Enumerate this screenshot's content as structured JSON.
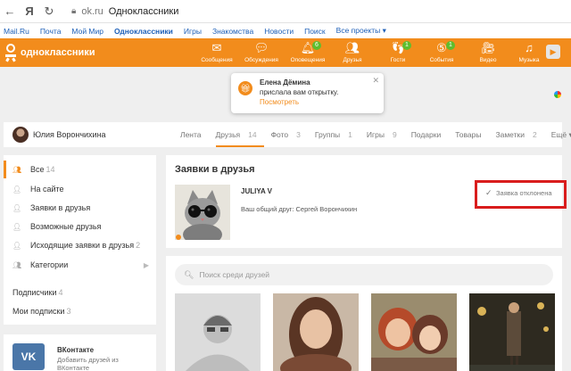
{
  "browser": {
    "url": "ok.ru",
    "page_title": "Одноклассники"
  },
  "portal_links": [
    "Mail.Ru",
    "Почта",
    "Мой Мир",
    "Одноклассники",
    "Игры",
    "Знакомства",
    "Новости",
    "Поиск",
    "Все проекты ▾"
  ],
  "ok_header": {
    "logo_text": "одноклассники",
    "nav": [
      {
        "label": "Сообщения",
        "icon": "envelope-icon",
        "badge": ""
      },
      {
        "label": "Обсуждения",
        "icon": "chat-bubbles-icon",
        "badge": ""
      },
      {
        "label": "Оповещения",
        "icon": "bell-icon",
        "badge": "6"
      },
      {
        "label": "Друзья",
        "icon": "friends-icon",
        "badge": ""
      },
      {
        "label": "Гости",
        "icon": "footprints-icon",
        "badge": "1"
      },
      {
        "label": "События",
        "icon": "events-icon",
        "badge": "1"
      },
      {
        "label": "Видео",
        "icon": "video-camera-icon",
        "badge": ""
      },
      {
        "label": "Музыка",
        "icon": "music-note-icon",
        "badge": ""
      }
    ],
    "accent_color": "#f28c1c"
  },
  "notification": {
    "name": "Елена Дёмина",
    "text": "прислала вам открытку.",
    "link": "Посмотреть"
  },
  "profile": {
    "name": "Юлия Ворончихина",
    "tabs": [
      {
        "label": "Лента",
        "count": ""
      },
      {
        "label": "Друзья",
        "count": "14"
      },
      {
        "label": "Фото",
        "count": "3"
      },
      {
        "label": "Группы",
        "count": "1"
      },
      {
        "label": "Игры",
        "count": "9"
      },
      {
        "label": "Подарки",
        "count": ""
      },
      {
        "label": "Товары",
        "count": ""
      },
      {
        "label": "Заметки",
        "count": "2"
      },
      {
        "label": "Ещё ▾",
        "count": ""
      }
    ]
  },
  "sidebar": {
    "items": [
      {
        "label": "Все",
        "count": "14",
        "icon": "friends-icon"
      },
      {
        "label": "На сайте",
        "count": "",
        "icon": "person-online-icon"
      },
      {
        "label": "Заявки в друзья",
        "count": "",
        "icon": "person-request-icon"
      },
      {
        "label": "Возможные друзья",
        "count": "",
        "icon": "person-suggest-icon"
      },
      {
        "label": "Исходящие заявки в друзья",
        "count": "2",
        "icon": "person-outgoing-icon"
      },
      {
        "label": "Категории",
        "count": "",
        "icon": "categories-icon"
      }
    ],
    "subscribers": {
      "label": "Подписчики",
      "count": "4"
    },
    "subscriptions": {
      "label": "Мои подписки",
      "count": "3"
    }
  },
  "vk_promo": {
    "logo": "VK",
    "title": "ВКонтакте",
    "line1": "Добавить друзей из",
    "line2": "ВКонтакте"
  },
  "requests": {
    "title": "Заявки в друзья",
    "request_name": "JULIYA V",
    "mutual": "Ваш общий друг: Сергей Ворончихин",
    "status": "Заявка отклонена"
  },
  "friends_search": {
    "placeholder": "Поиск среди друзей"
  }
}
